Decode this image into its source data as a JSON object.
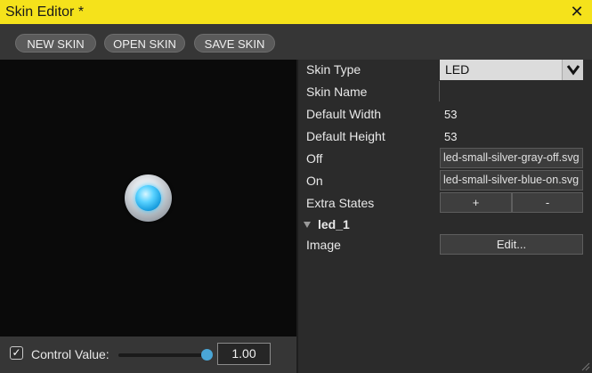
{
  "window": {
    "title": "Skin Editor *",
    "close_glyph": "✕"
  },
  "toolbar": {
    "new_skin": "NEW SKIN",
    "open_skin": "OPEN SKIN",
    "save_skin": "SAVE SKIN"
  },
  "preview": {
    "led_state": "on",
    "led_color": "#1ea9ea"
  },
  "control": {
    "checkbox_checked": true,
    "check_glyph": "✓",
    "label": "Control Value:",
    "slider_value": 1.0,
    "value_text": "1.00"
  },
  "properties": {
    "skin_type_label": "Skin Type",
    "skin_type_value": "LED",
    "skin_name_label": "Skin Name",
    "skin_name_value": "",
    "default_width_label": "Default Width",
    "default_width_value": "53",
    "default_height_label": "Default Height",
    "default_height_value": "53",
    "off_label": "Off",
    "off_value": "led-small-silver-gray-off.svg",
    "on_label": "On",
    "on_value": "led-small-silver-blue-on.svg",
    "extra_states_label": "Extra States",
    "add_label": "+",
    "remove_label": "-",
    "state_name": "led_1",
    "image_label": "Image",
    "edit_label": "Edit..."
  },
  "colors": {
    "titlebar": "#f5e21b",
    "accent": "#4aa6d6"
  }
}
